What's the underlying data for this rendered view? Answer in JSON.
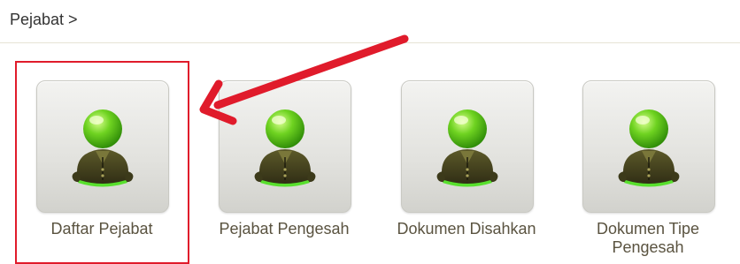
{
  "breadcrumb": {
    "text": "Pejabat >"
  },
  "tiles": [
    {
      "label": "Daftar Pejabat",
      "icon": "user-officer-icon"
    },
    {
      "label": "Pejabat Pengesah",
      "icon": "user-officer-icon"
    },
    {
      "label": "Dokumen Disahkan",
      "icon": "user-officer-icon"
    },
    {
      "label": "Dokumen Tipe Pengesah",
      "icon": "user-officer-icon"
    }
  ],
  "annotation": {
    "highlight_color": "#e01b2b",
    "target": "Daftar Pejabat"
  }
}
